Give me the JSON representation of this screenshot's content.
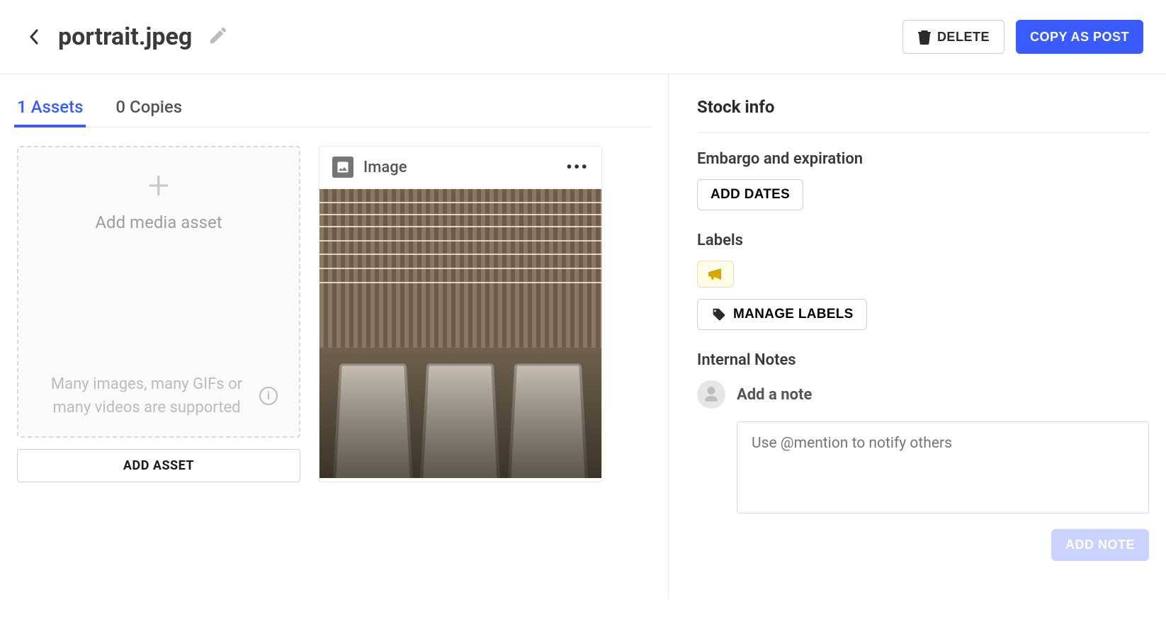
{
  "header": {
    "title": "portrait.jpeg",
    "delete_label": "DELETE",
    "copy_label": "COPY AS POST"
  },
  "tabs": {
    "assets": "1 Assets",
    "copies": "0 Copies"
  },
  "upload": {
    "title": "Add media asset",
    "subtitle": "Many images, many GIFs or many videos are supported",
    "add_button": "ADD ASSET"
  },
  "asset": {
    "type_label": "Image"
  },
  "sidebar": {
    "stock_info": "Stock info",
    "embargo_label": "Embargo and expiration",
    "add_dates": "ADD DATES",
    "labels_label": "Labels",
    "manage_labels": "MANAGE LABELS",
    "notes_label": "Internal Notes",
    "note_title": "Add a note",
    "note_placeholder": "Use @mention to notify others",
    "add_note": "ADD NOTE"
  }
}
